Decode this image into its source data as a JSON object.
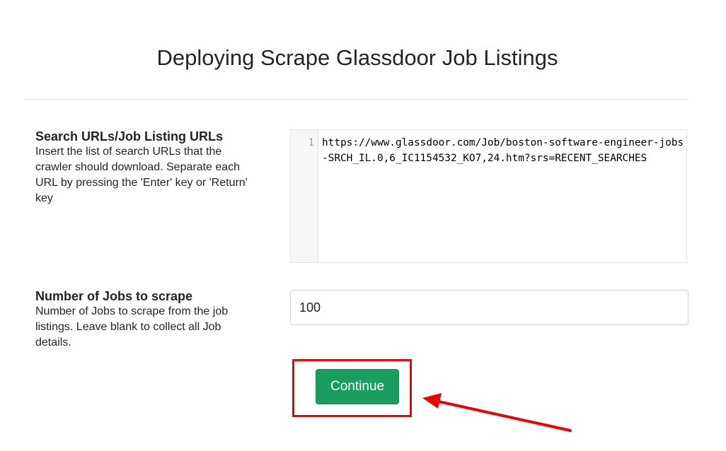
{
  "page": {
    "title": "Deploying Scrape Glassdoor Job Listings"
  },
  "search_urls": {
    "label": "Search URLs/Job Listing URLs",
    "help": "Insert the list of search URLs that the crawler should download. Separate each URL by pressing the 'Enter' key or 'Return' key",
    "line_number": "1",
    "value": "https://www.glassdoor.com/Job/boston-software-engineer-jobs-SRCH_IL.0,6_IC1154532_KO7,24.htm?srs=RECENT_SEARCHES"
  },
  "num_jobs": {
    "label": "Number of Jobs to scrape",
    "help": "Number of Jobs to scrape from the job listings. Leave blank to collect all Job details.",
    "value": "100"
  },
  "actions": {
    "continue_label": "Continue"
  },
  "colors": {
    "button": "#1a9e5f",
    "highlight": "#ee0000"
  }
}
